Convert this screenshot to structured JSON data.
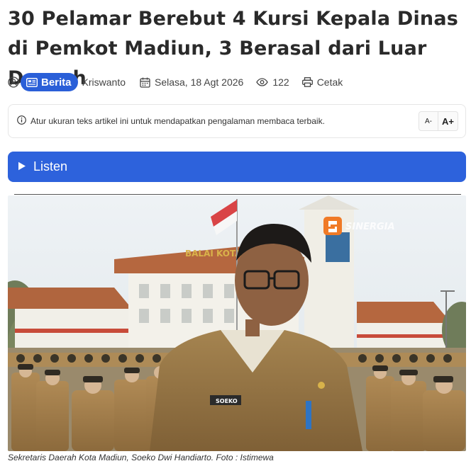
{
  "article": {
    "title": "30 Pelamar Berebut 4 Kursi Kepala Dinas di Pemkot Madiun, 3 Berasal dari Luar Daerah"
  },
  "meta": {
    "category": "Berita",
    "author": "Kriswanto",
    "date": "Selasa, 18 Agt 2026",
    "views": "122",
    "print_label": "Cetak"
  },
  "text_size": {
    "notice": "Atur ukuran teks artikel ini untuk mendapatkan pengalaman membaca terbaik.",
    "decrease_label": "A-",
    "increase_label": "A+"
  },
  "listen": {
    "label": "Listen",
    "color": "#2d62dc"
  },
  "photo": {
    "building_sign": "BALAI KOTA",
    "watermark": "SINERGIA",
    "name_tag": "SOEKO",
    "caption": "Sekretaris Daerah Kota Madiun, Soeko Dwi Handiarto. Foto : Istimewa"
  },
  "colors": {
    "accent": "#2a5fd8",
    "uniform": "#b08a55"
  }
}
